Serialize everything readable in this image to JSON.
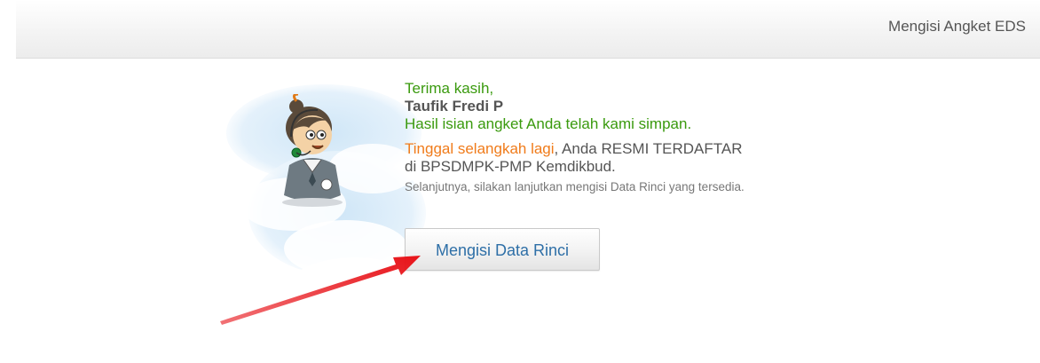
{
  "header": {
    "title": "Mengisi Angket EDS"
  },
  "message": {
    "thanks": "Terima kasih,",
    "user_name": "Taufik Fredi P",
    "saved": "Hasil isian angket Anda telah kami simpan.",
    "remaining_highlight": "Tinggal selangkah lagi",
    "remaining_rest": ", Anda RESMI TERDAFTAR",
    "registered_at": "di BPSDMPK-PMP Kemdikbud.",
    "next_step": "Selanjutnya, silakan lanjutkan mengisi Data Rinci yang tersedia."
  },
  "actions": {
    "fill_detail_label": "Mengisi Data Rinci"
  },
  "colors": {
    "green_text": "#3a9a0e",
    "orange_text": "#f07b1a",
    "button_text": "#2e6fa7",
    "arrow": "#e8141a"
  },
  "icons": {
    "mascot": "operator-mascot-icon",
    "arrow": "red-arrow-icon"
  }
}
